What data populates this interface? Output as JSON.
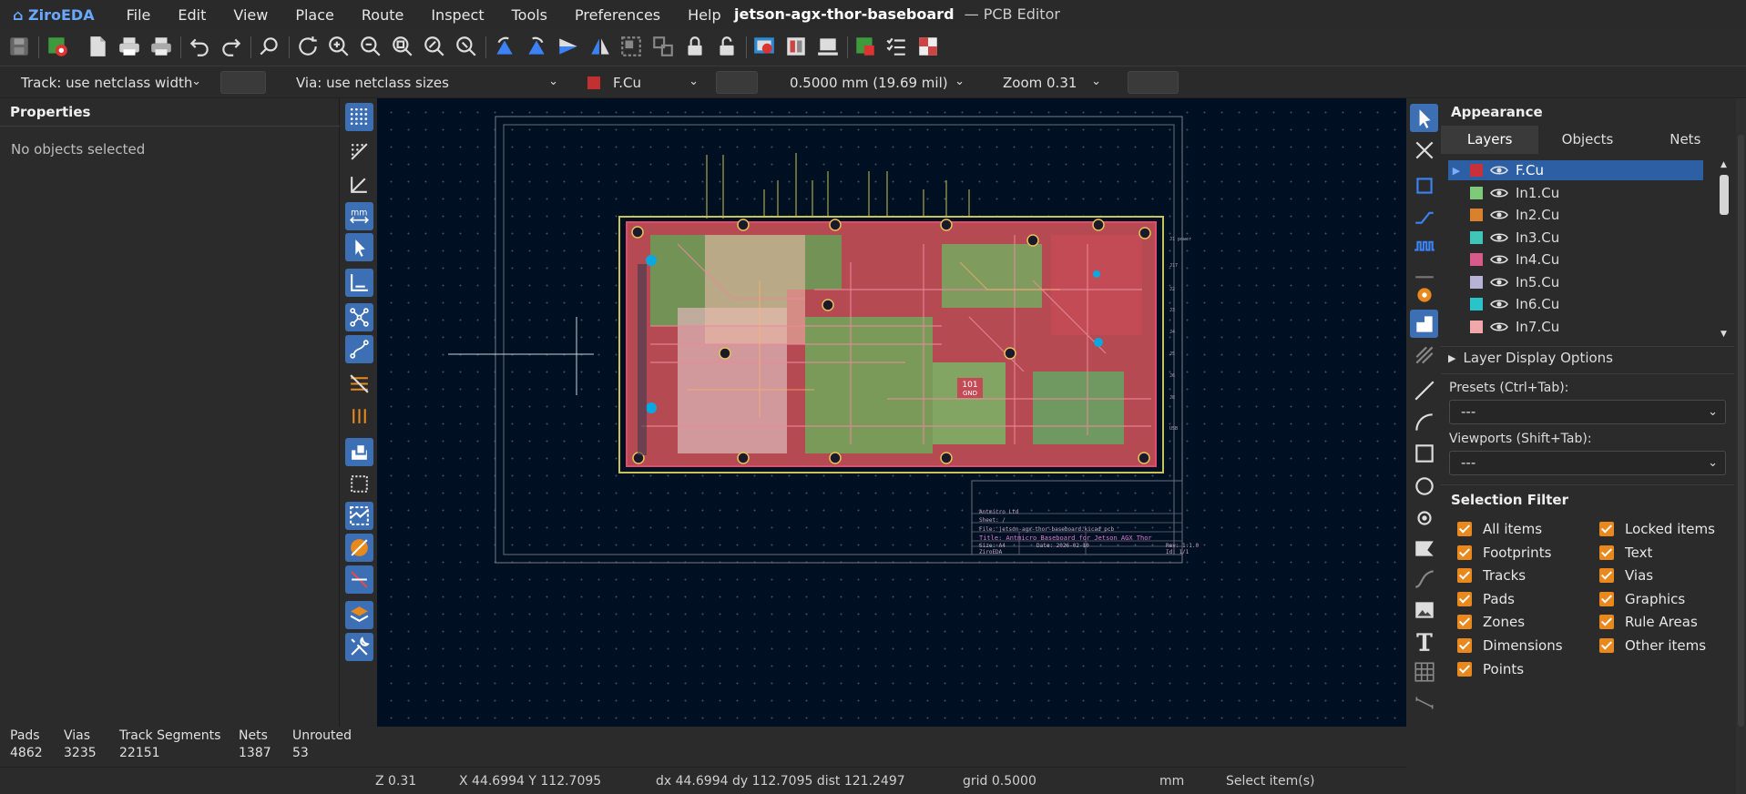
{
  "app": {
    "logo": "⌂ ZiroEDA",
    "file_title": "jetson-agx-thor-baseboard",
    "editor_title": "— PCB Editor"
  },
  "menu": [
    "File",
    "Edit",
    "View",
    "Place",
    "Route",
    "Inspect",
    "Tools",
    "Preferences",
    "Help"
  ],
  "options": {
    "track": "Track: use netclass width",
    "via": "Via: use netclass sizes",
    "layer": "F.Cu",
    "layer_color": "#c23131",
    "grid": "0.5000 mm (19.69 mil)",
    "zoom": "Zoom 0.31"
  },
  "properties": {
    "title": "Properties",
    "empty_text": "No objects selected"
  },
  "appearance": {
    "title": "Appearance",
    "tabs": [
      "Layers",
      "Objects",
      "Nets"
    ],
    "layers": [
      {
        "name": "F.Cu",
        "color": "#c8313a",
        "selected": true
      },
      {
        "name": "In1.Cu",
        "color": "#7fc97a"
      },
      {
        "name": "In2.Cu",
        "color": "#d9822b"
      },
      {
        "name": "In3.Cu",
        "color": "#3fc6b8"
      },
      {
        "name": "In4.Cu",
        "color": "#d85a8a"
      },
      {
        "name": "In5.Cu",
        "color": "#b7b3d6"
      },
      {
        "name": "In6.Cu",
        "color": "#29c4c9"
      },
      {
        "name": "In7.Cu",
        "color": "#f0a9a8"
      }
    ],
    "layer_display_options": "Layer Display Options",
    "presets_label": "Presets (Ctrl+Tab):",
    "presets_value": "---",
    "viewports_label": "Viewports (Shift+Tab):",
    "viewports_value": "---"
  },
  "selection_filter": {
    "title": "Selection Filter",
    "left": [
      "All items",
      "Footprints",
      "Tracks",
      "Pads",
      "Zones",
      "Dimensions",
      "Points"
    ],
    "right": [
      "Locked items",
      "Text",
      "Vias",
      "Graphics",
      "Rule Areas",
      "Other items"
    ]
  },
  "stats": {
    "headers": [
      "Pads",
      "Vias",
      "Track Segments",
      "Nets",
      "Unrouted"
    ],
    "values": [
      "4862",
      "3235",
      "22151",
      "1387",
      "53"
    ]
  },
  "status": {
    "zoom": "Z 0.31",
    "xy": "X 44.6994 Y 112.7095",
    "delta": "dx 44.6994 dy 112.7095 dist 121.2497",
    "grid": "grid 0.5000",
    "units": "mm",
    "mode": "Select item(s)"
  },
  "title_block": {
    "company": "Antmicro Ltd",
    "sheet": "Sheet: /",
    "file": "File: jetson-agx-thor-baseboard.kicad_pcb",
    "title": "Title: Antmicro Baseboard for Jetson AGX Thor",
    "size": "Size: A4",
    "date": "Date: 2026-02-10",
    "rev": "Rev: 1.1.0",
    "id": "Id: 1/1",
    "tool": "ZiroEDA"
  },
  "board_label": "101\nGND"
}
